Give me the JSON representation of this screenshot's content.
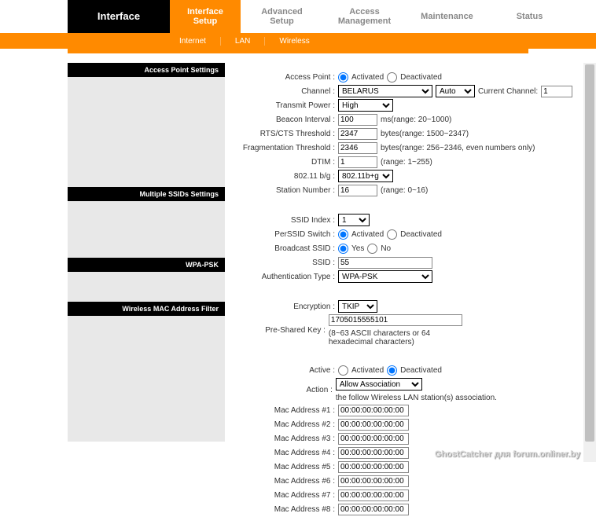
{
  "topTabs": {
    "main": "Interface",
    "t1": "Interface\nSetup",
    "t2": "Advanced\nSetup",
    "t3": "Access\nManagement",
    "t4": "Maintenance",
    "t5": "Status"
  },
  "subTabs": {
    "s1": "Internet",
    "s2": "LAN",
    "s3": "Wireless"
  },
  "sidebar": {
    "ap": "Access Point Settings",
    "ssid": "Multiple SSIDs Settings",
    "wpa": "WPA-PSK",
    "mac": "Wireless MAC Address Filter"
  },
  "labels": {
    "accessPoint": "Access Point :",
    "channel": "Channel :",
    "currentChannel": "Current Channel:",
    "transmitPower": "Transmit Power :",
    "beacon": "Beacon Interval :",
    "rts": "RTS/CTS Threshold :",
    "frag": "Fragmentation Threshold :",
    "dtim": "DTIM :",
    "mode": "802.11 b/g :",
    "station": "Station Number :",
    "ssidIndex": "SSID Index :",
    "perSsid": "PerSSID Switch :",
    "broadcast": "Broadcast SSID :",
    "ssid": "SSID :",
    "authType": "Authentication Type :",
    "encryption": "Encryption :",
    "psk": "Pre-Shared Key :",
    "active": "Active :",
    "action": "Action :",
    "mac1": "Mac Address #1 :",
    "mac2": "Mac Address #2 :",
    "mac3": "Mac Address #3 :",
    "mac4": "Mac Address #4 :",
    "mac5": "Mac Address #5 :",
    "mac6": "Mac Address #6 :",
    "mac7": "Mac Address #7 :",
    "mac8": "Mac Address #8 :"
  },
  "radios": {
    "activated": "Activated",
    "deactivated": "Deactivated",
    "yes": "Yes",
    "no": "No"
  },
  "values": {
    "channelCountry": "BELARUS",
    "channelAuto": "Auto",
    "currentChannel": "1",
    "transmit": "High",
    "beacon": "100",
    "rts": "2347",
    "frag": "2346",
    "dtim": "1",
    "mode": "802.11b+g",
    "station": "16",
    "ssidIndex": "1",
    "ssid": "55",
    "authType": "WPA-PSK",
    "encryption": "TKIP",
    "psk": "1705015555101",
    "action": "Allow Association",
    "macDefault": "00:00:00:00:00:00"
  },
  "hints": {
    "beacon": "ms(range: 20~1000)",
    "rts": "bytes(range: 1500~2347)",
    "frag": "bytes(range: 256~2346, even numbers only)",
    "dtim": "(range: 1~255)",
    "station": "(range: 0~16)",
    "psk": "(8~63 ASCII characters or 64 hexadecimal characters)",
    "action": "the follow Wireless LAN station(s) association."
  },
  "watermark": "GhostCatcher для forum.onliner.by"
}
